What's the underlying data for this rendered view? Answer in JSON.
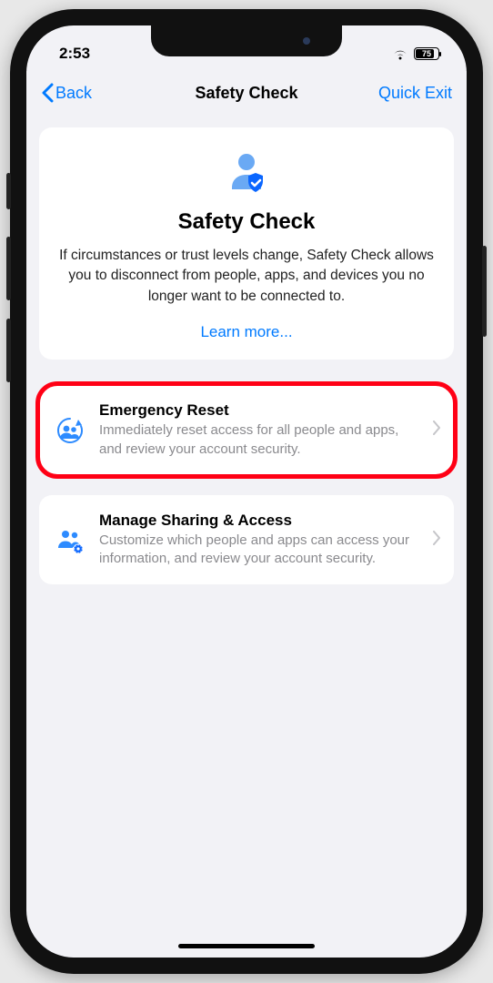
{
  "status": {
    "time": "2:53",
    "battery": "75"
  },
  "nav": {
    "back": "Back",
    "title": "Safety Check",
    "quickExit": "Quick Exit"
  },
  "hero": {
    "title": "Safety Check",
    "body": "If circumstances or trust levels change, Safety Check allows you to disconnect from people, apps, and devices you no longer want to be connected to.",
    "learnMore": "Learn more..."
  },
  "options": {
    "emergency": {
      "title": "Emergency Reset",
      "desc": "Immediately reset access for all people and apps, and review your account security."
    },
    "manage": {
      "title": "Manage Sharing & Access",
      "desc": "Customize which people and apps can access your information, and review your account security."
    }
  }
}
